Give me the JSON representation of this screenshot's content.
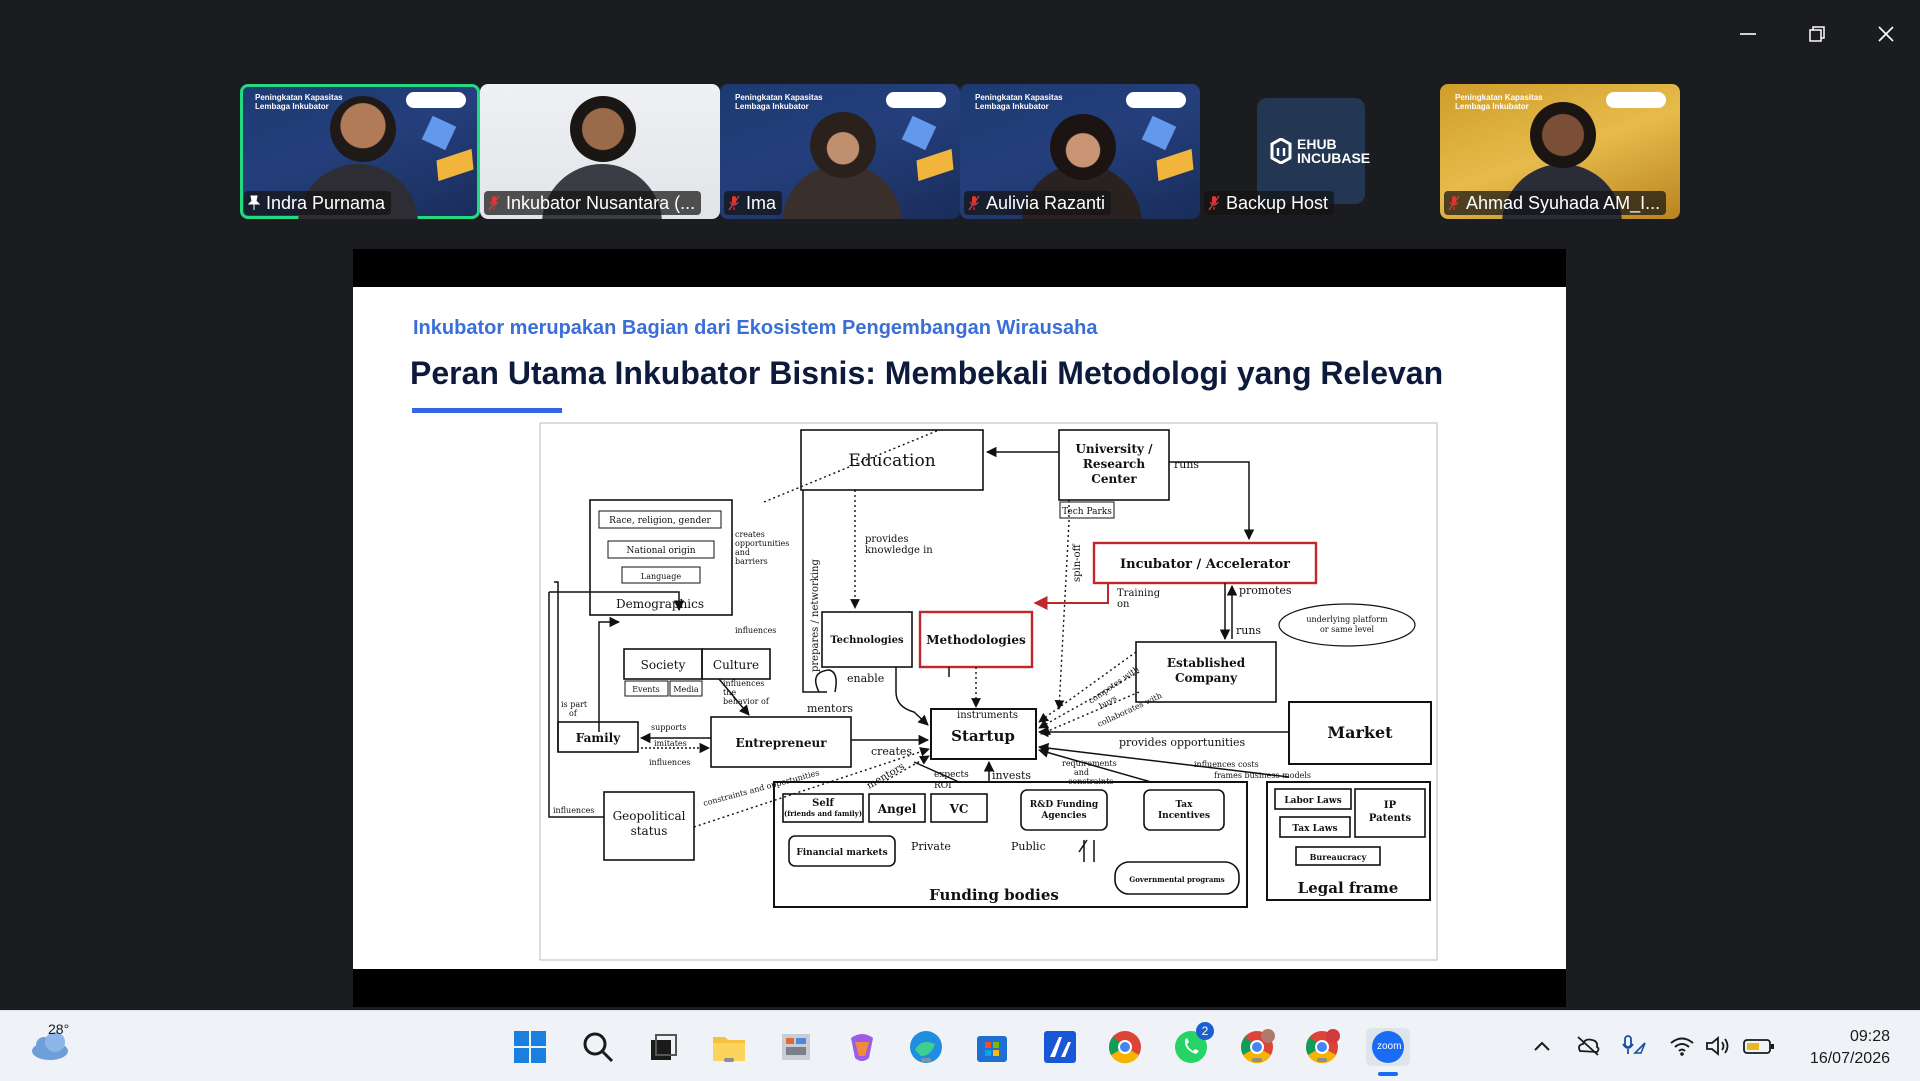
{
  "participants": [
    {
      "name": "Indra Purnama",
      "muted": false,
      "pinned": true,
      "brand": "Peningkatan Kapasitas Lembaga Inkubator"
    },
    {
      "name": "Inkubator Nusantara (...",
      "muted": true
    },
    {
      "name": "Ima",
      "muted": true,
      "brand": "Peningkatan Kapasitas Lembaga Inkubator"
    },
    {
      "name": "Aulivia Razanti",
      "muted": true,
      "brand": "Peningkatan Kapasitas Lembaga Inkubator"
    },
    {
      "name": "Backup Host",
      "muted": true,
      "logo": "EHUB INCUBASE"
    },
    {
      "name": "Ahmad Syuhada AM_I...",
      "muted": true,
      "brand": "Peningkatan Kapasitas Lembaga Inkubator"
    }
  ],
  "slide": {
    "subtitle": "Inkubator merupakan Bagian dari Ekosistem Pengembangan Wirausaha",
    "title": "Peran Utama Inkubator Bisnis: Membekali Metodologi yang Relevan"
  },
  "diagram": {
    "education": "Education",
    "university": [
      "University /",
      "Research",
      "Center"
    ],
    "tech_parks": "Tech Parks",
    "runs": "runs",
    "incubator": "Incubator / Accelerator",
    "training_on": [
      "Training",
      "on"
    ],
    "promotes": "promotes",
    "runs2": "runs",
    "platform": [
      "underlying platform",
      "or same level"
    ],
    "established": [
      "Established",
      "Company"
    ],
    "demographics": "Demographics",
    "race": "Race, religion, gender",
    "national": "National origin",
    "language": "Language",
    "creates_opp": [
      "creates",
      "opportunities",
      "and",
      "barriers"
    ],
    "influences": "influences",
    "prepares": "prepares / networking",
    "provides_knowledge": [
      "provides",
      "knowledge in"
    ],
    "spin_off": "spin-off",
    "technologies": "Technologies",
    "methodologies": "Methodologies",
    "society": "Society",
    "culture": "Culture",
    "events": "Events",
    "media": "Media",
    "influences_behavior": [
      "influences",
      "the",
      "behavior of"
    ],
    "enable": "enable",
    "mentors": "mentors",
    "instruments": "instruments",
    "is_part_of": [
      "is part",
      "of"
    ],
    "supports": "supports",
    "imitates": "imitates",
    "influences2": "influences",
    "family": "Family",
    "entrepreneur": "Entrepreneur",
    "creates": "creates",
    "startup": "Startup",
    "competes": "competes with",
    "buys": "buys",
    "collaborates": "collaborates with",
    "provides_opp": "provides opportunities",
    "market": "Market",
    "influences3": "influences",
    "geopolitical": [
      "Geopolitical",
      "status"
    ],
    "constraints_opp": "constraints and opportunities",
    "mentors2": "mentors",
    "expects_roi": [
      "expects",
      "ROI"
    ],
    "invests": "invests",
    "requirements": [
      "requirements",
      "and",
      "constraints"
    ],
    "influences_costs": [
      "influences costs",
      "frames business models"
    ],
    "self": [
      "Self",
      "(friends and family)"
    ],
    "angel": "Angel",
    "vc": "VC",
    "rd": [
      "R&D Funding",
      "Agencies"
    ],
    "tax_inc": [
      "Tax",
      "Incentives"
    ],
    "private": "Private",
    "public": "Public",
    "fin_markets": "Financial markets",
    "gov_programs": "Governmental programs",
    "funding": "Funding bodies",
    "labor": "Labor Laws",
    "tax_laws": "Tax Laws",
    "ip": [
      "IP",
      "Patents"
    ],
    "bureaucracy": "Bureaucracy",
    "legal": "Legal frame"
  },
  "taskbar": {
    "weather_temp": "28°",
    "whatsapp_badge": "2",
    "time": "09:28",
    "date": "16/07/2026",
    "zoom_label": "zoom"
  },
  "colors": {
    "active_speaker": "#23d982",
    "accent_blue": "#3b6fd8",
    "incubator_red": "#c0272d"
  }
}
